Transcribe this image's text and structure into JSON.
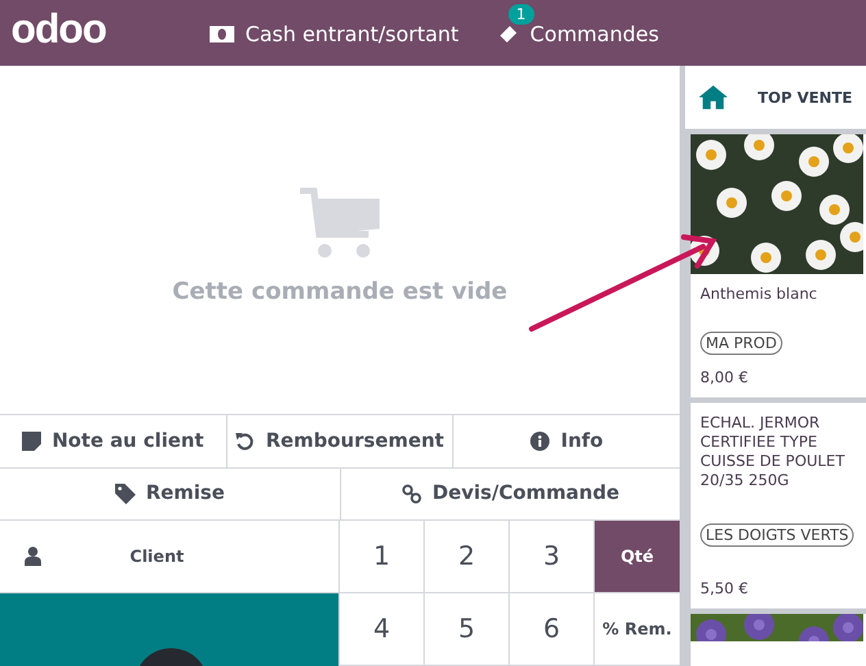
{
  "header": {
    "logo": "odoo",
    "menu": [
      {
        "kind": "cash",
        "label": "Cash entrant/sortant"
      },
      {
        "kind": "orders",
        "label": "Commandes",
        "badge": "1"
      }
    ]
  },
  "order": {
    "empty_message": "Cette commande est vide"
  },
  "actions": [
    [
      {
        "kind": "note",
        "label": "Note au client"
      },
      {
        "kind": "refund",
        "label": "Remboursement"
      },
      {
        "kind": "info",
        "label": "Info"
      }
    ],
    [
      {
        "kind": "tag",
        "label": "Remise"
      },
      {
        "kind": "link",
        "label": "Devis/Commande"
      }
    ]
  ],
  "client": {
    "label": "Client"
  },
  "numpad": [
    [
      {
        "label": "1",
        "selected": false
      },
      {
        "label": "2",
        "selected": false
      },
      {
        "label": "3",
        "selected": false
      },
      {
        "label": "Qté",
        "selected": true
      }
    ],
    [
      {
        "label": "4",
        "selected": false
      },
      {
        "label": "5",
        "selected": false
      },
      {
        "label": "6",
        "selected": false
      },
      {
        "label": "% Rem.",
        "selected": false
      }
    ]
  ],
  "categories": {
    "label": "TOP VENTE"
  },
  "products": [
    {
      "kind": "picture",
      "name": "Anthemis blanc",
      "tag": "MA PROD",
      "price": "8,00 €"
    },
    {
      "kind": "text",
      "name": "ECHAL. JERMOR CERTIFIEE TYPE CUISSE DE POULET 20/35 250G",
      "tag": "LES DOIGTS VERTS",
      "price": "5,50 €"
    },
    {
      "kind": "picture"
    }
  ]
}
